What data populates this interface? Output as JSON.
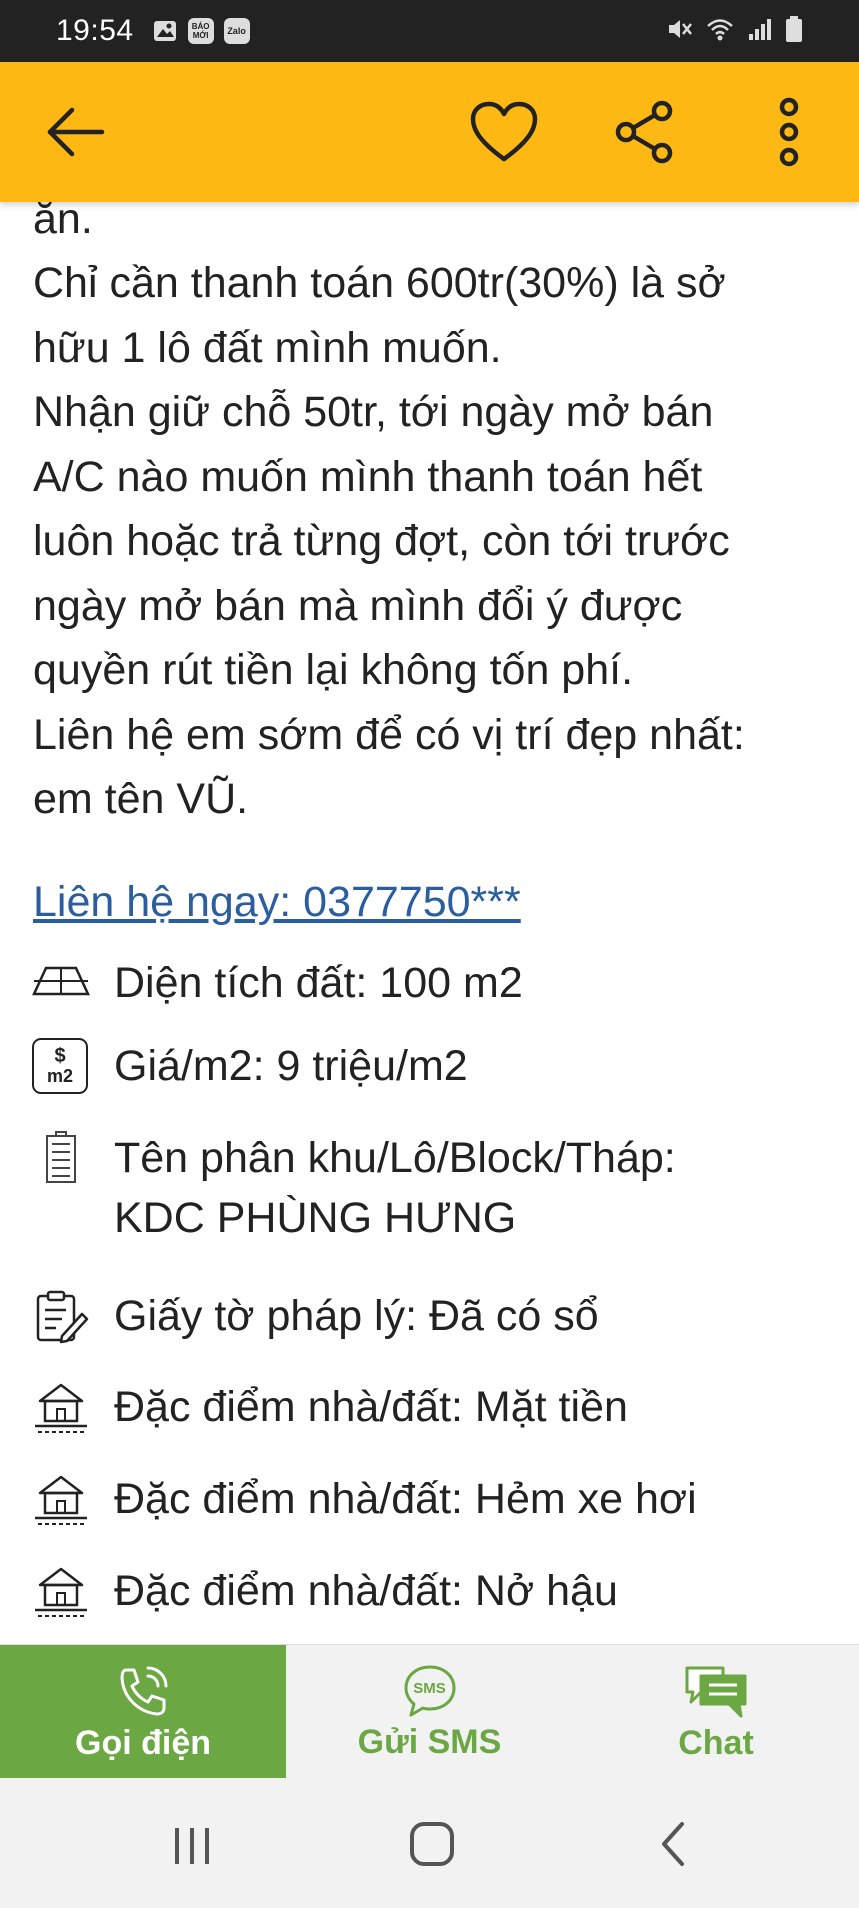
{
  "status_bar": {
    "time": "19:54",
    "apps": [
      "image-icon",
      "BÁO MỚI",
      "Zalo"
    ]
  },
  "app_bar": {
    "back": "arrow-left-icon",
    "favorite": "heart-icon",
    "share": "share-icon",
    "more": "more-vertical-icon"
  },
  "description": {
    "lines": [
      "ăn.",
      "Chỉ cần thanh toán 600tr(30%) là sở",
      "hữu 1 lô đất mình muốn.",
      "Nhận giữ chỗ 50tr, tới ngày mở bán",
      "A/C nào muốn mình thanh toán hết",
      "luôn hoặc trả từng đợt, còn tới trước",
      "ngày mở bán mà mình đổi ý được",
      "quyền rút tiền lại không tốn phí.",
      "Liên hệ em sớm để có vị trí đẹp nhất:",
      "em tên VŨ."
    ]
  },
  "contact_link": "Liên hệ ngay: 0377750***",
  "attributes": {
    "area": "Diện tích đất: 100 m2",
    "price_per_m2": "Giá/m2: 9 triệu/m2",
    "block_line1": "Tên phân khu/Lô/Block/Tháp:",
    "block_line2": "KDC PHÙNG HƯNG",
    "legal": "Giấy tờ pháp lý: Đã có sổ",
    "feature1": "Đặc điểm nhà/đất: Mặt tiền",
    "feature2": "Đặc điểm nhà/đất: Hẻm xe hơi",
    "feature3": "Đặc điểm nhà/đất: Nở hậu",
    "price_icon_top": "$",
    "price_icon_bottom": "m2"
  },
  "actions": {
    "call": "Gọi điện",
    "sms": "Gửi SMS",
    "sms_badge": "SMS",
    "chat": "Chat"
  },
  "colors": {
    "app_bar": "#FDB813",
    "call_bg": "#6BA743",
    "accent_green": "#6BA743",
    "link": "#2b5e9e"
  }
}
